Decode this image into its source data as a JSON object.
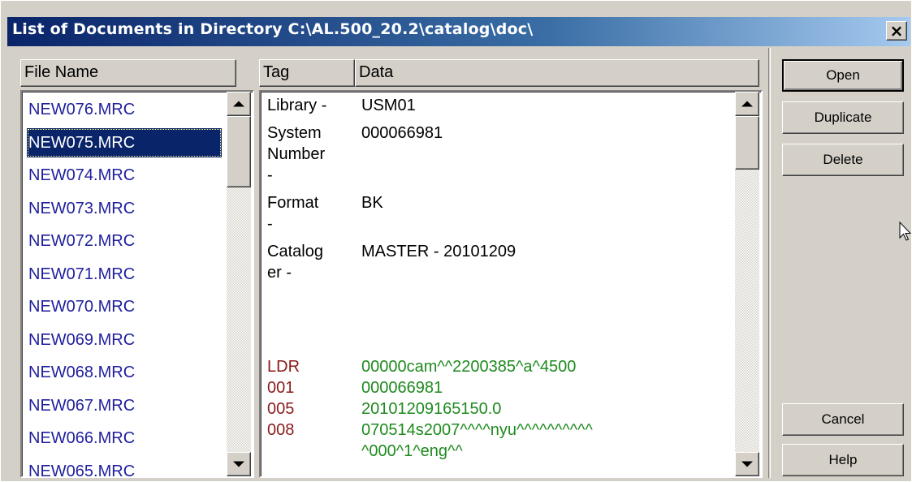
{
  "window": {
    "title": "List of Documents in Directory C:\\AL.500_20.2\\catalog\\doc\\",
    "close_label": "×"
  },
  "file_list": {
    "header": "File Name",
    "items": [
      "NEW076.MRC",
      "NEW075.MRC",
      "NEW074.MRC",
      "NEW073.MRC",
      "NEW072.MRC",
      "NEW071.MRC",
      "NEW070.MRC",
      "NEW069.MRC",
      "NEW068.MRC",
      "NEW067.MRC",
      "NEW066.MRC",
      "NEW065.MRC"
    ],
    "selected": "NEW075.MRC"
  },
  "record_view": {
    "headers": {
      "tag": "Tag",
      "data": "Data"
    },
    "summary": [
      {
        "tag_lines": [
          "Library -"
        ],
        "data_lines": [
          "USM01"
        ]
      },
      {
        "tag_lines": [
          "System",
          "Number",
          "-"
        ],
        "data_lines": [
          "000066981"
        ]
      },
      {
        "tag_lines": [
          "Format",
          "-"
        ],
        "data_lines": [
          "BK"
        ]
      },
      {
        "tag_lines": [
          "Catalog",
          "er -"
        ],
        "data_lines": [
          "MASTER - 20101209"
        ]
      }
    ],
    "fields": [
      {
        "tag": "LDR",
        "data_lines": [
          "00000cam^^2200385^a^4500"
        ]
      },
      {
        "tag": "001",
        "data_lines": [
          "000066981"
        ]
      },
      {
        "tag": "005",
        "data_lines": [
          "20101209165150.0"
        ]
      },
      {
        "tag": "008",
        "data_lines": [
          "070514s2007^^^^nyu^^^^^^^^^^",
          "^000^1^eng^^"
        ]
      }
    ],
    "colors": {
      "tag": "#8b1a1a",
      "data": "#1e8a1e",
      "file_text": "#1f1f9e",
      "selection": "#0a246a"
    }
  },
  "buttons": {
    "open": "Open",
    "duplicate": "Duplicate",
    "delete": "Delete",
    "cancel": "Cancel",
    "help": "Help"
  }
}
